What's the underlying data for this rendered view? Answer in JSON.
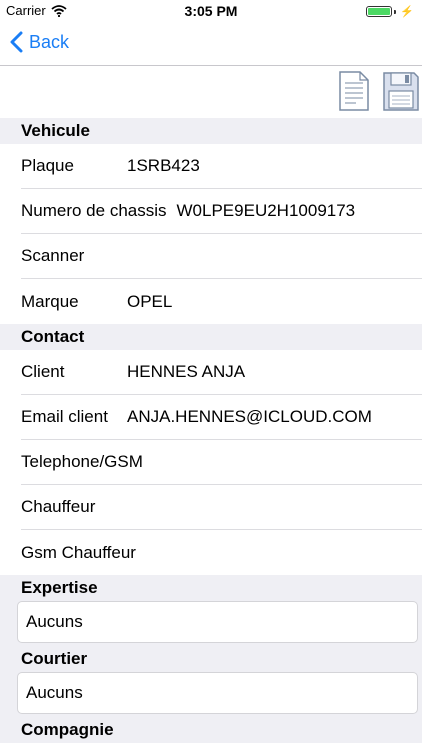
{
  "status": {
    "carrier": "Carrier",
    "time": "3:05 PM"
  },
  "nav": {
    "back_label": "Back"
  },
  "sections": {
    "vehicule": {
      "title": "Vehicule",
      "plaque": {
        "label": "Plaque",
        "value": "1SRB423"
      },
      "chassis": {
        "label": "Numero de chassis",
        "value": "W0LPE9EU2H1009173"
      },
      "scanner": {
        "label": "Scanner"
      },
      "marque": {
        "label": "Marque",
        "value": "OPEL"
      }
    },
    "contact": {
      "title": "Contact",
      "client": {
        "label": "Client",
        "value": "HENNES ANJA"
      },
      "email": {
        "label": "Email client",
        "value": "ANJA.HENNES@ICLOUD.COM"
      },
      "telephone": {
        "label": "Telephone/GSM"
      },
      "chauffeur": {
        "label": "Chauffeur"
      },
      "gsm_chauffeur": {
        "label": "Gsm Chauffeur"
      }
    },
    "expertise": {
      "title": "Expertise",
      "value": "Aucuns"
    },
    "courtier": {
      "title": "Courtier",
      "value": "Aucuns"
    },
    "compagnie": {
      "title": "Compagnie"
    }
  },
  "colors": {
    "accent": "#1a7ef5",
    "section_bg": "#efeff4",
    "battery": "#4cd964",
    "icon_stroke": "#7a8ba3"
  },
  "icons": [
    "wifi-icon",
    "battery-icon",
    "charging-bolt-icon",
    "chevron-left-icon",
    "document-icon",
    "save-disk-icon"
  ]
}
